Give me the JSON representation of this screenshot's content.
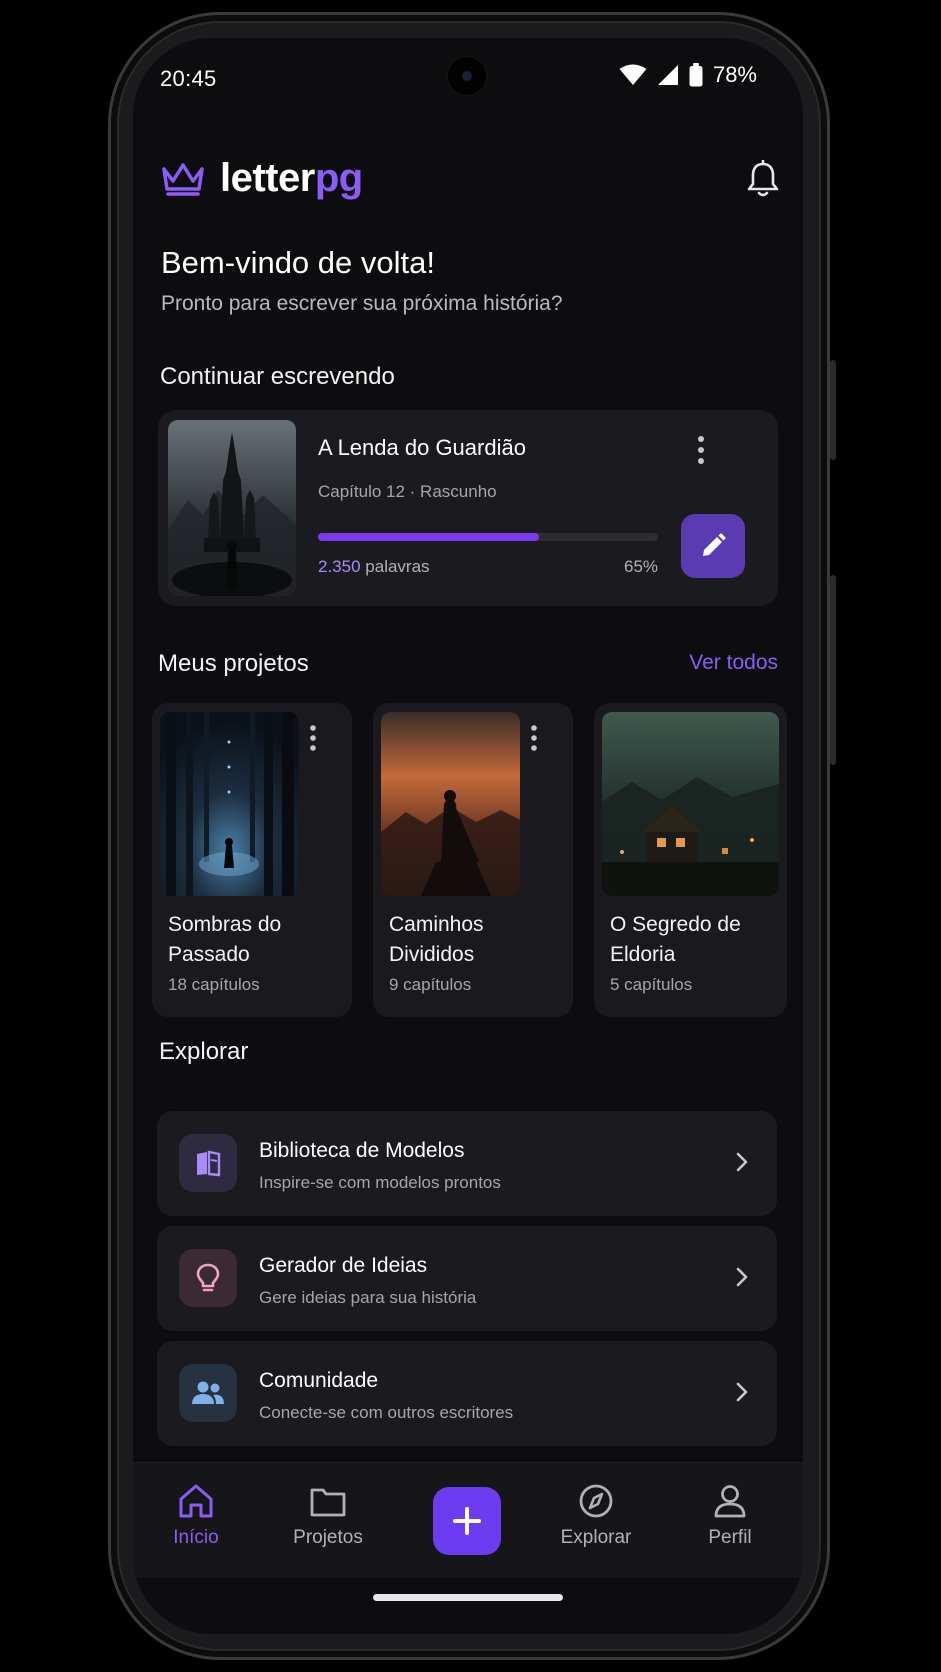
{
  "status": {
    "time": "20:45",
    "battery": "78%"
  },
  "header": {
    "logo_part1": "letter",
    "logo_part2": "pg"
  },
  "welcome": {
    "title": "Bem-vindo de volta!",
    "subtitle": "Pronto para escrever sua próxima história?"
  },
  "continue": {
    "section_title": "Continuar escrevendo",
    "title": "A Lenda do Guardião",
    "meta": "Capítulo 12 · Rascunho",
    "words_num": "2.350",
    "words_label": "palavras",
    "progress_pct": "65%",
    "progress_value": 0.65
  },
  "projects": {
    "section_title": "Meus projetos",
    "see_all": "Ver todos",
    "items": [
      {
        "title": "Sombras do Passado",
        "meta": "18 capítulos"
      },
      {
        "title": "Caminhos Divididos",
        "meta": "9 capítulos"
      },
      {
        "title": "O Segredo de Eldoria",
        "meta": "5 capítulos"
      }
    ]
  },
  "explore": {
    "section_title": "Explorar",
    "items": [
      {
        "title": "Biblioteca de Modelos",
        "desc": "Inspire-se com modelos prontos",
        "icon": "book-icon"
      },
      {
        "title": "Gerador de Ideias",
        "desc": "Gere ideias para sua história",
        "icon": "lightbulb-icon"
      },
      {
        "title": "Comunidade",
        "desc": "Conecte-se com outros escritores",
        "icon": "people-icon"
      }
    ]
  },
  "nav": {
    "items": [
      {
        "label": "Início",
        "icon": "home-icon",
        "active": true
      },
      {
        "label": "Projetos",
        "icon": "folder-icon",
        "active": false
      },
      {
        "label": "Explorar",
        "icon": "compass-icon",
        "active": false
      },
      {
        "label": "Perfil",
        "icon": "user-icon",
        "active": false
      }
    ],
    "fab_icon": "plus-icon"
  },
  "colors": {
    "accent": "#8b5cf6",
    "fab": "#6d3cf0",
    "edit_button": "#5b3bb1",
    "card": "#1b1b1f",
    "background": "#0d0d0f"
  }
}
